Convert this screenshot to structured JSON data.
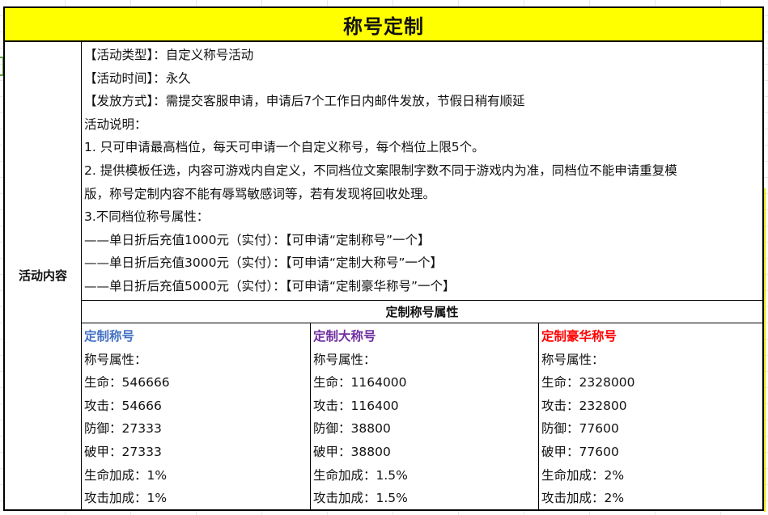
{
  "title": "称号定制",
  "left_label": "活动内容",
  "description_lines": [
    "【活动类型】：自定义称号活动",
    "【活动时间】：永久",
    "【发放方式】：需提交客服申请，申请后7个工作日内邮件发放，节假日稍有顺延",
    "活动说明：",
    "1. 只可申请最高档位，每天可申请一个自定义称号，每个档位上限5个。",
    "2. 提供模板任选，内容可游戏内自定义，不同档位文案限制字数不同于游戏内为准，同档位不能申请重复模",
    "版，称号定制内容不能有辱骂敏感词等，若有发现将回收处理。",
    "3.不同档位称号属性：",
    "——单日折后充值1000元（实付）：【可申请“定制称号”一个】",
    "——单日折后充值3000元（实付）：【可申请“定制大称号”一个】",
    "——单日折后充值5000元（实付）：【可申请“定制豪华称号”一个】"
  ],
  "attr_header": "定制称号属性",
  "tiers": [
    {
      "name": "定制称号",
      "color": "#4472c4",
      "lines": [
        "称号属性：",
        "生命：546666",
        "攻击：54666",
        "防御：27333",
        "破甲：27333",
        "生命加成：1%",
        "攻击加成：1%"
      ]
    },
    {
      "name": "定制大称号",
      "color": "#7030a0",
      "lines": [
        "称号属性：",
        "生命：1164000",
        "攻击：116400",
        "防御：38800",
        "破甲：38800",
        "生命加成：1.5%",
        "攻击加成：1.5%"
      ]
    },
    {
      "name": "定制豪华称号",
      "color": "#ff0000",
      "lines": [
        "称号属性：",
        "生命：2328000",
        "攻击：232800",
        "防御：77600",
        "破甲：77600",
        "生命加成：2%",
        "攻击加成：2%"
      ]
    }
  ]
}
